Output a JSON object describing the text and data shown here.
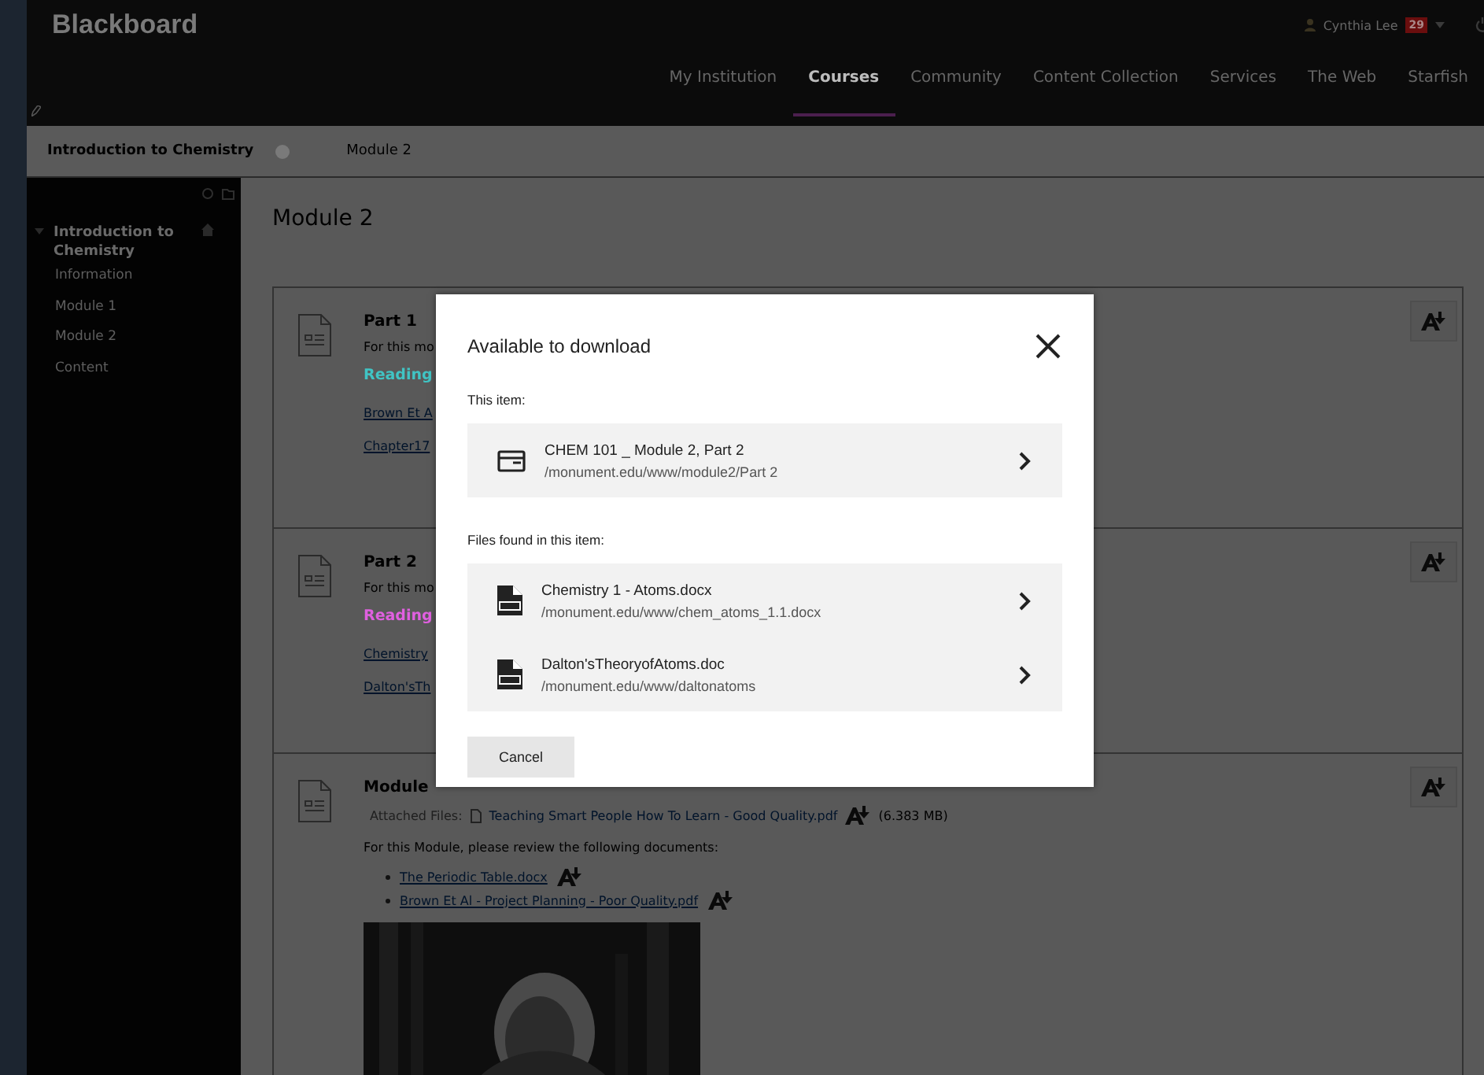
{
  "header": {
    "logo": "Blackboard",
    "user": "Cynthia Lee",
    "badge": "29",
    "nav": [
      {
        "label": "My Institution",
        "selected": false
      },
      {
        "label": "Courses",
        "selected": true
      },
      {
        "label": "Community",
        "selected": false
      },
      {
        "label": "Content Collection",
        "selected": false
      },
      {
        "label": "Services",
        "selected": false
      },
      {
        "label": "The Web",
        "selected": false
      },
      {
        "label": "Starfish",
        "selected": false
      }
    ]
  },
  "breadcrumb": [
    "Introduction to Chemistry",
    "Module 2"
  ],
  "sidebar": {
    "course": "Introduction to Chemistry",
    "expanded": true,
    "items": [
      "Information",
      "Module 1",
      "Module 2",
      "Content"
    ]
  },
  "page_title": "Module 2",
  "cards": [
    {
      "kind": "item",
      "title": "Part 1",
      "text": "For this mo",
      "heading": "Reading",
      "color": "#40c4c4",
      "links": [
        "Brown Et A",
        "Chapter17"
      ]
    },
    {
      "kind": "item",
      "title": "Part 2",
      "text": "For this mo",
      "heading": "Reading",
      "color": "#e060e0",
      "links": [
        "Chemistry",
        "Dalton'sTh"
      ]
    },
    {
      "kind": "module",
      "title": "Module",
      "attached_label": "Attached Files:",
      "attachment": "Teaching Smart People How To Learn - Good Quality.pdf",
      "size": "(6.383 MB)",
      "text": "For this Module, please review the following documents:",
      "links": [
        "The Periodic Table.docx",
        "Brown Et Al - Project Planning - Poor Quality.pdf"
      ],
      "picture": {
        "kind": "picture"
      }
    }
  ],
  "modal": {
    "title": "Available to download",
    "this_item_label": "This item:",
    "this_item": {
      "name": "CHEM 101 _ Module 2, Part 2",
      "path": "/monument.edu/www/module2/Part 2"
    },
    "files_label": "Files found in this item:",
    "files": [
      {
        "name": "Chemistry 1 - Atoms.docx",
        "path": "/monument.edu/www/chem_atoms_1.1.docx"
      },
      {
        "name": "Dalton'sTheoryofAtoms.doc",
        "path": "/monument.edu/www/daltonatoms"
      }
    ],
    "cancel": "Cancel"
  }
}
